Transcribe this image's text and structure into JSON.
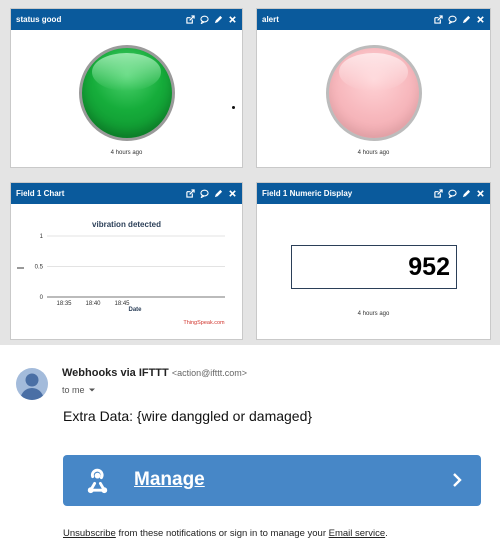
{
  "widgets": {
    "status_good": {
      "title": "status good",
      "updated": "4 hours ago"
    },
    "alert": {
      "title": "alert",
      "updated": "4 hours ago"
    },
    "field1_chart": {
      "title": "Field 1 Chart"
    },
    "field1_numeric": {
      "title": "Field 1 Numeric Display",
      "value": "952",
      "updated": "4 hours ago"
    },
    "header_icons": [
      "external-link-icon",
      "comment-icon",
      "pencil-icon",
      "close-icon"
    ]
  },
  "chart_data": {
    "type": "line",
    "title": "vibration detected",
    "xlabel": "Date",
    "ylabel": "",
    "x_ticks": [
      "18:35",
      "18:40",
      "18:45"
    ],
    "y_ticks": [
      "0",
      "0.5",
      "1"
    ],
    "ylim": [
      0,
      1
    ],
    "series": [
      {
        "points": []
      }
    ],
    "grid": true,
    "watermark": "ThingSpeak.com"
  },
  "email": {
    "sender_name": "Webhooks via IFTTT",
    "sender_address": "<action@ifttt.com>",
    "recipient": "to me",
    "body": "Extra Data: {wire danggled or damaged}",
    "button_label": "Manage",
    "footer": {
      "link1": "Unsubscribe",
      "text1": " from these notifications or sign in to manage your ",
      "link2": "Email service",
      "text2": "."
    }
  },
  "colors": {
    "widget_header": "#0a5a9c",
    "lamp_on": "#16ad3b",
    "lamp_off": "#f7b8bd",
    "button": "#4787c7",
    "watermark": "#d0342c"
  }
}
